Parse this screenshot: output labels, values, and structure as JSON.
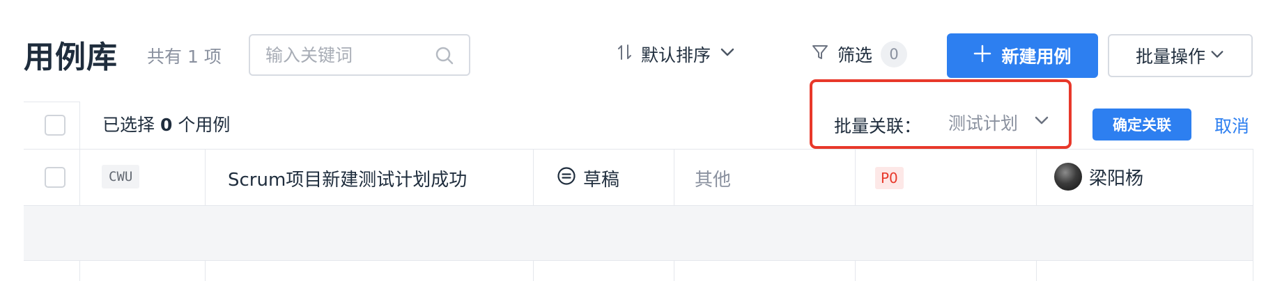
{
  "header": {
    "title": "用例库",
    "count_text": "共有 1 项",
    "search": {
      "placeholder": "输入关键词",
      "value": ""
    },
    "sort": {
      "icon": "sort-icon",
      "label": "默认排序"
    },
    "filter": {
      "icon": "filter-icon",
      "label": "筛选",
      "count": "0"
    },
    "new_case_button": {
      "icon": "plus-icon",
      "label": "新建用例"
    },
    "batch_ops_button": {
      "label": "批量操作"
    }
  },
  "selection_bar": {
    "selected_prefix": "已选择",
    "selected_count": "0",
    "selected_suffix": "个用例",
    "batch_link_label": "批量关联：",
    "batch_link_select": "测试计划",
    "confirm_label": "确定关联",
    "cancel_label": "取消"
  },
  "rows": [
    {
      "id": "CWU",
      "title": "Scrum项目新建测试计划成功",
      "status": "草稿",
      "type": "其他",
      "priority": "P0",
      "owner": "梁阳杨"
    }
  ],
  "colors": {
    "primary": "#2d7ff0",
    "highlight_border": "#e8382a",
    "priority_bg": "#fde8e7",
    "priority_text": "#e8382a"
  }
}
